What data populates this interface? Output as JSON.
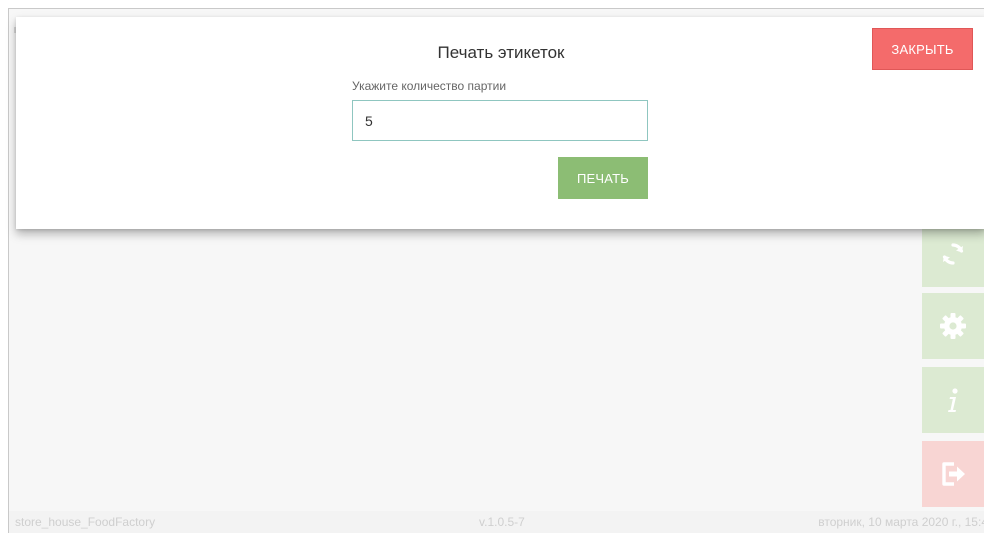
{
  "modal": {
    "title": "Печать этикеток",
    "close_label": "ЗАКРЫТЬ",
    "field_label": "Укажите количество партии",
    "quantity_value": "5",
    "print_label": "ПЕЧАТЬ"
  },
  "sidebar": {
    "buttons": [
      {
        "name": "sync-button",
        "icon": "sync-icon"
      },
      {
        "name": "settings-button",
        "icon": "gear-icon"
      },
      {
        "name": "info-button",
        "icon": "info-icon"
      },
      {
        "name": "logout-button",
        "icon": "logout-icon"
      }
    ]
  },
  "footer": {
    "store": "store_house_FoodFactory",
    "version": "v.1.0.5-7",
    "datetime": "вторник, 10 марта 2020 г., 15:4"
  },
  "colors": {
    "close_button": "#f46b6b",
    "print_button": "#8cbd74",
    "side_button_green": "#dcead2",
    "side_button_red": "#f8d5d3",
    "input_border": "#8fc6c0"
  }
}
